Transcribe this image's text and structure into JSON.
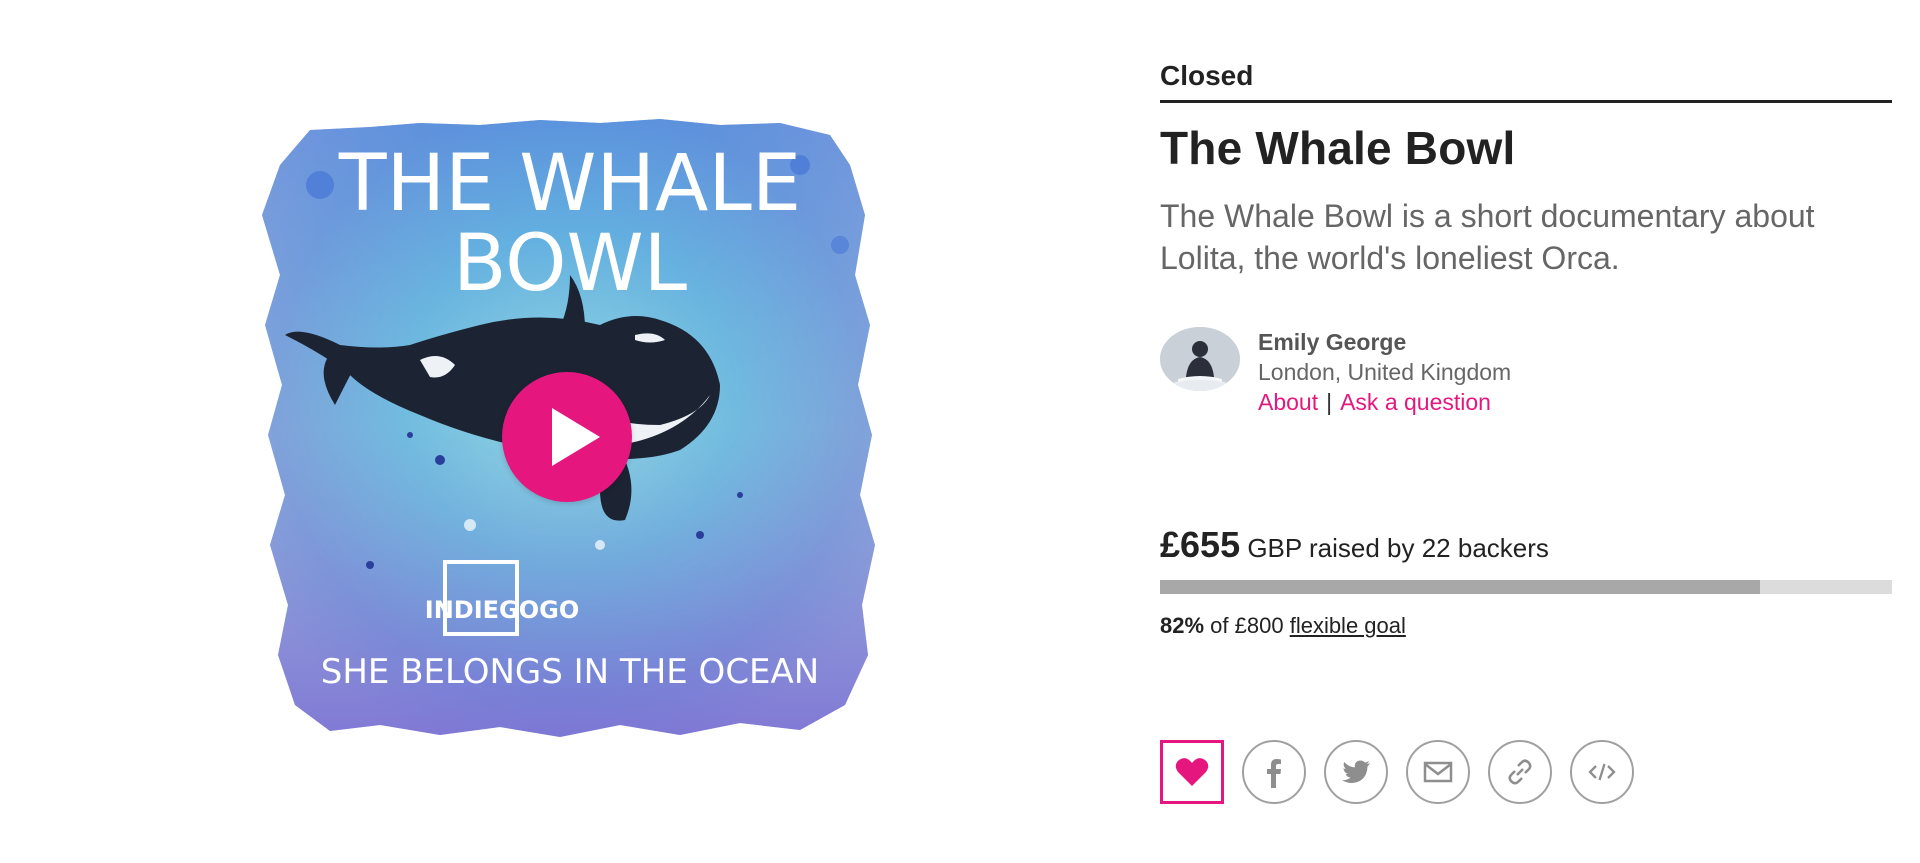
{
  "campaign": {
    "status": "Closed",
    "title": "The Whale Bowl",
    "tagline": "The Whale Bowl is a short documentary about Lolita, the world's loneliest Orca."
  },
  "media": {
    "poster_title_line1": "THE WHALE",
    "poster_title_line2": "BOWL",
    "poster_brand": "INDIEGOGO",
    "poster_caption": "SHE BELONGS IN THE OCEAN",
    "play_icon": "play-icon"
  },
  "owner": {
    "name": "Emily George",
    "location": "London, United Kingdom",
    "about_label": "About",
    "separator": "|",
    "ask_label": "Ask a question"
  },
  "funding": {
    "amount": "£655",
    "raised_text": "GBP raised by 22 backers",
    "percent": "82%",
    "percent_value": 82,
    "goal_text": "of £800",
    "goal_type": "flexible goal"
  },
  "share": {
    "icons": [
      "heart-icon",
      "facebook-icon",
      "twitter-icon",
      "email-icon",
      "link-icon",
      "embed-icon"
    ]
  },
  "colors": {
    "accent": "#e5177f",
    "bar_fill": "#a8a8a8",
    "bar_track": "#dcdcdc"
  }
}
